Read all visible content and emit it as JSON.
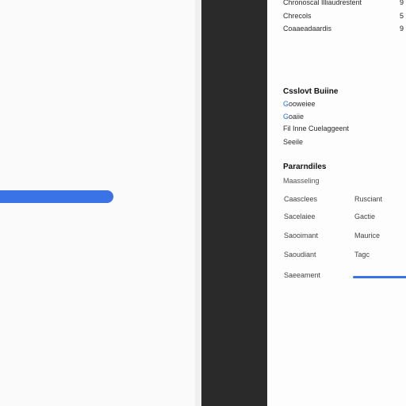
{
  "top_rows": [
    {
      "label": "Chronoscal Illiaudrestent",
      "value": "9"
    },
    {
      "label": "Chrecols",
      "value": "5"
    },
    {
      "label": "Coaaeadaardis",
      "value": "9"
    }
  ],
  "custom": {
    "title": "Csslovt Buiine",
    "items": [
      "Gooweiee",
      "Goaiie",
      "Fil Inne Cuelaggeent",
      "Seeile"
    ]
  },
  "parameters": {
    "title": "Pararndiles",
    "subtitle": "Maasseling",
    "rows": [
      {
        "name": "Caasclees",
        "value": "Rusciant"
      },
      {
        "name": "Sacelaiee",
        "value": "Gactie"
      },
      {
        "name": "Saooimant",
        "value": "Maurice"
      },
      {
        "name": "Saoudiant",
        "value": "Tagc"
      },
      {
        "name": "Saeeament",
        "value": ""
      }
    ]
  },
  "progress": {
    "fill_fraction": 0.58
  },
  "slider": {
    "accent": "#3a73e6"
  },
  "colors": {
    "accent": "#3a73e6",
    "dark_panel": "#2a2a2a",
    "background": "#fafafa"
  }
}
